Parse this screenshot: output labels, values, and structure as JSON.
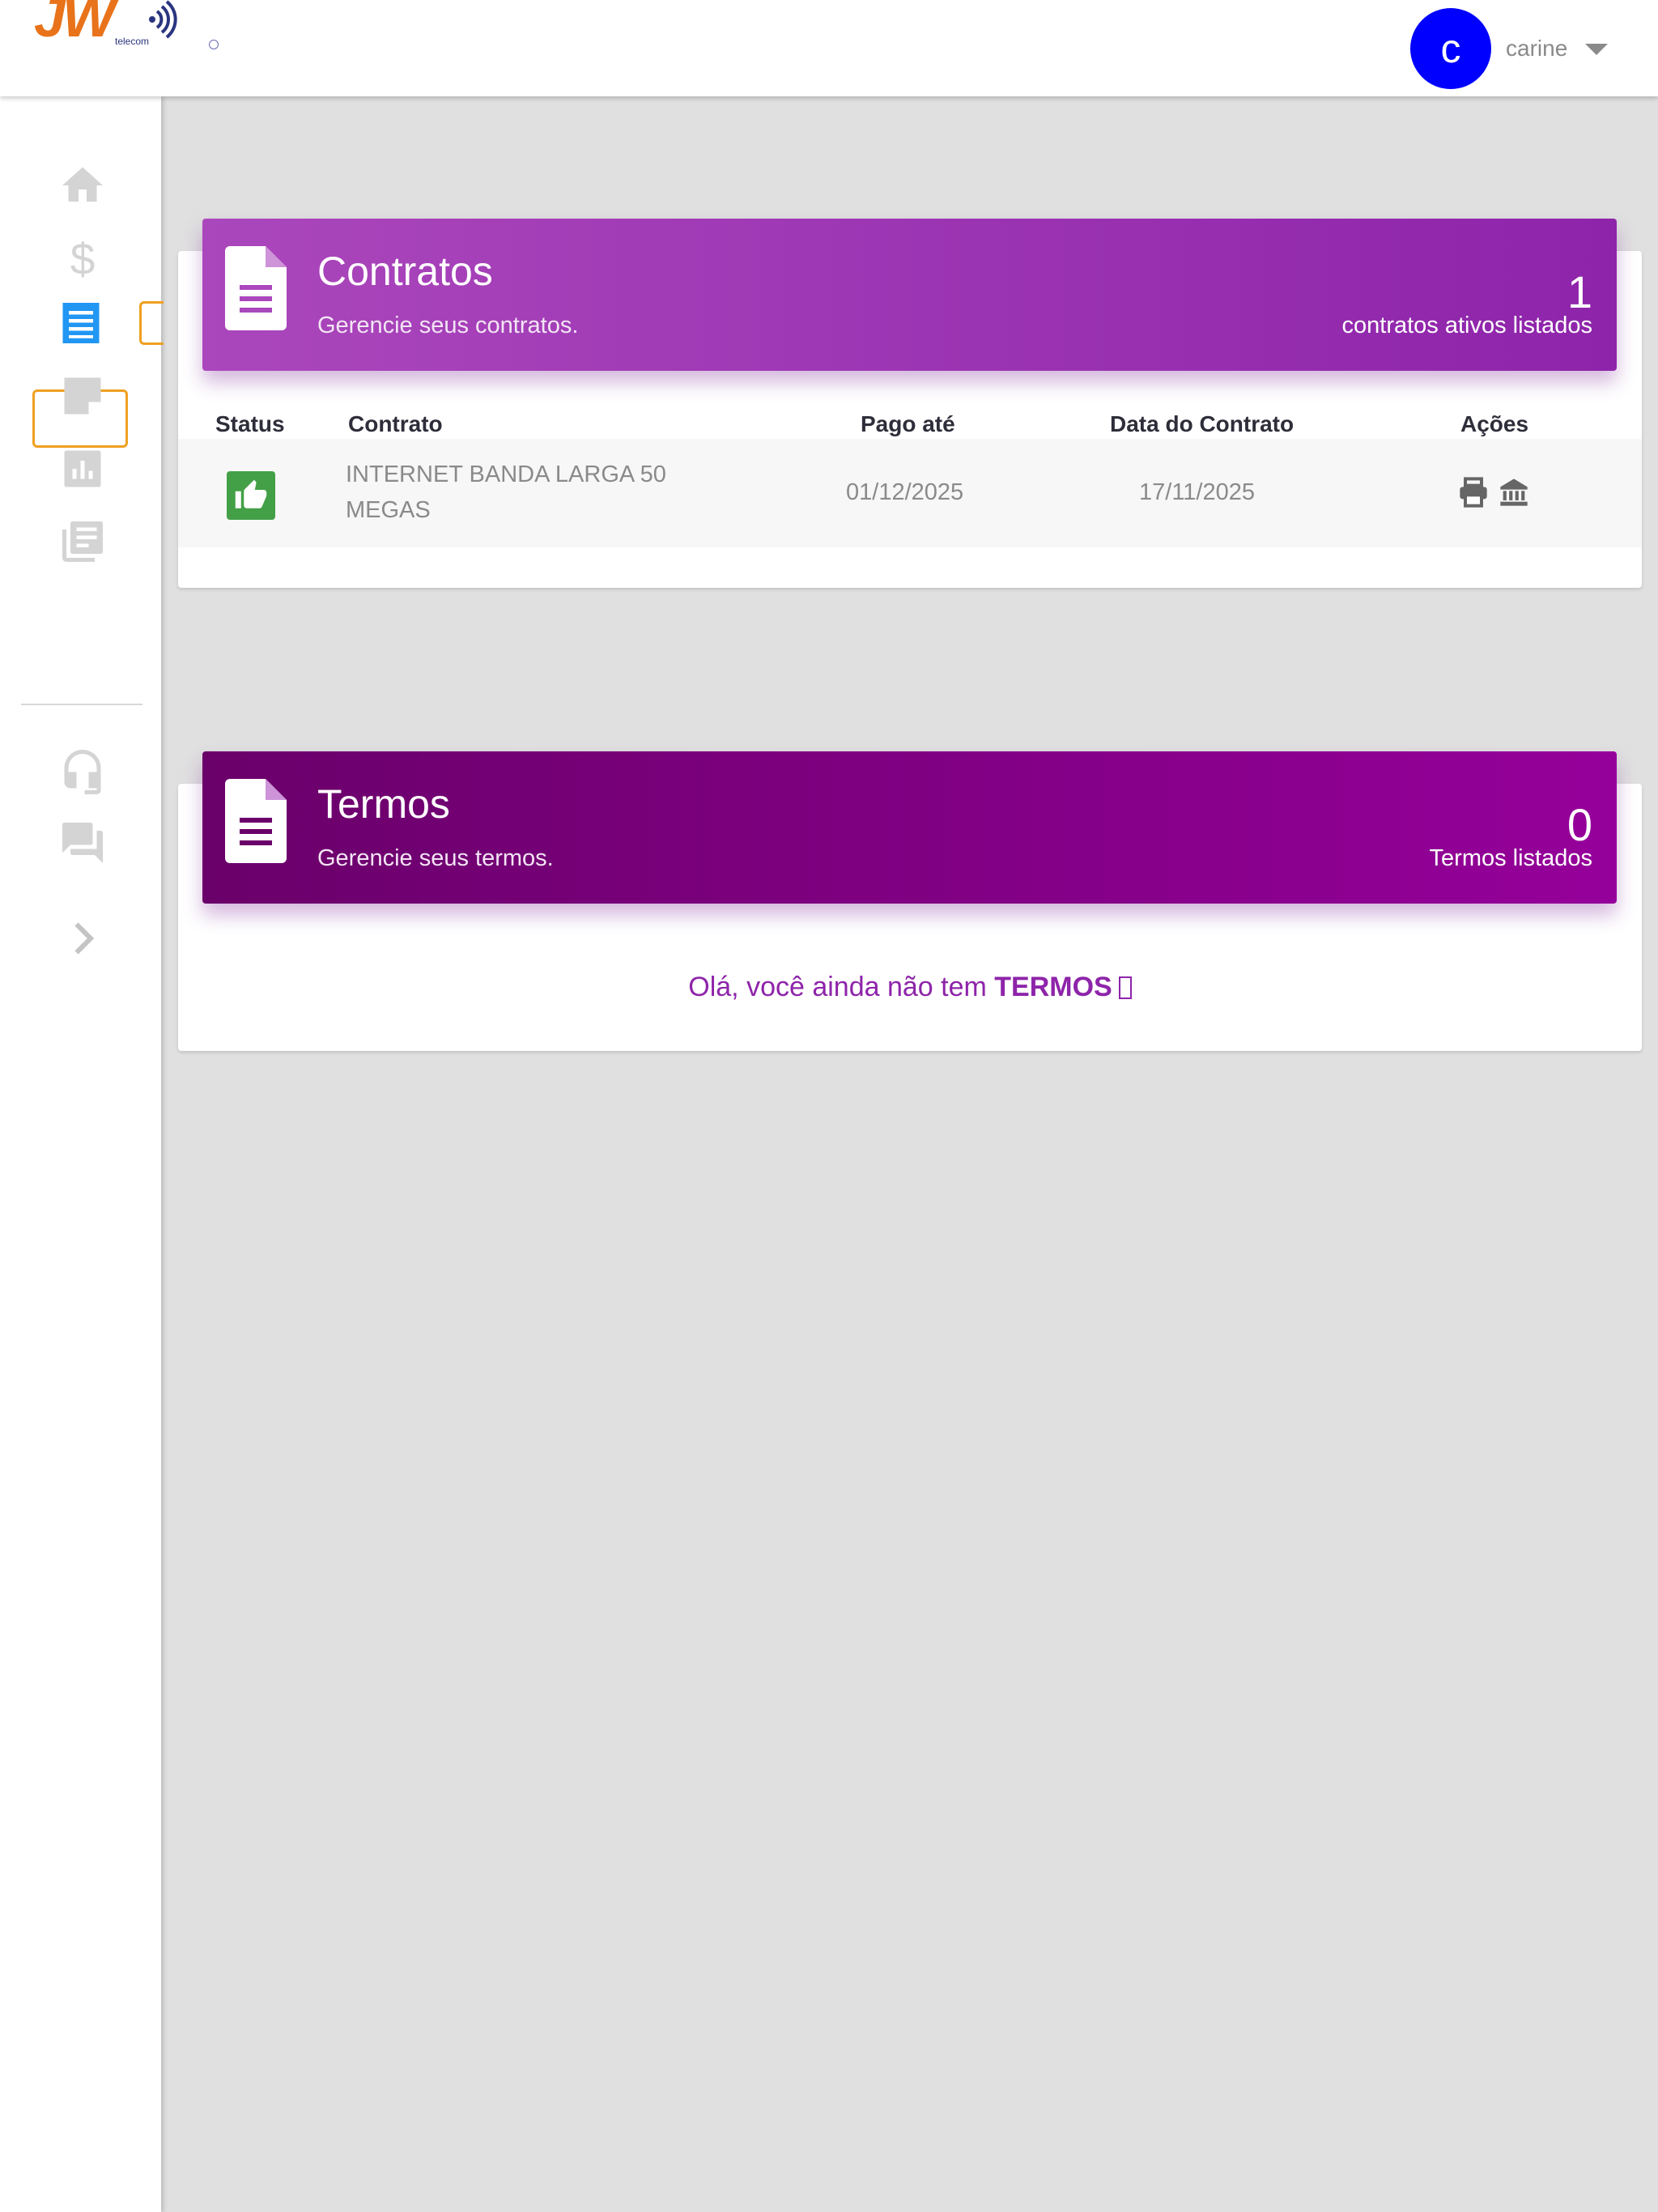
{
  "brand": {
    "logo_text": "JW",
    "logo_sub": "telecom"
  },
  "user": {
    "initial": "c",
    "name": "carine"
  },
  "sidebar": {
    "items": [
      {
        "name": "home",
        "active": false
      },
      {
        "name": "financeiro",
        "active": false
      },
      {
        "name": "contratos",
        "active": true
      },
      {
        "name": "documentos",
        "active": false
      },
      {
        "name": "consumo",
        "active": false
      },
      {
        "name": "noticias",
        "active": false
      },
      {
        "name": "suporte",
        "active": false
      },
      {
        "name": "atendimentos",
        "active": false
      },
      {
        "name": "expand",
        "active": false
      }
    ]
  },
  "contratos": {
    "title": "Contratos",
    "subtitle": "Gerencie seus contratos.",
    "count": "1",
    "count_label": "contratos ativos listados",
    "columns": [
      "Status",
      "Contrato",
      "Pago até",
      "Data do Contrato",
      "Ações"
    ],
    "rows": [
      {
        "status": "ativo",
        "contrato_line1": "INTERNET BANDA LARGA 50",
        "contrato_line2": "MEGAS",
        "pago_ate": "01/12/2025",
        "data_contrato": "17/11/2025"
      }
    ]
  },
  "termos": {
    "title": "Termos",
    "subtitle": "Gerencie seus termos.",
    "count": "0",
    "count_label": "Termos listados",
    "empty_prefix": "Olá, você ainda não tem ",
    "empty_bold": "TERMOS"
  },
  "colors": {
    "accent": "#8e24aa",
    "contratos_header": "#ab47bc",
    "termos_header": "#800080",
    "status_ok": "#43a047",
    "avatar": "#0000ff",
    "active_icon": "#2196f3",
    "active_outline": "#f0a020"
  }
}
